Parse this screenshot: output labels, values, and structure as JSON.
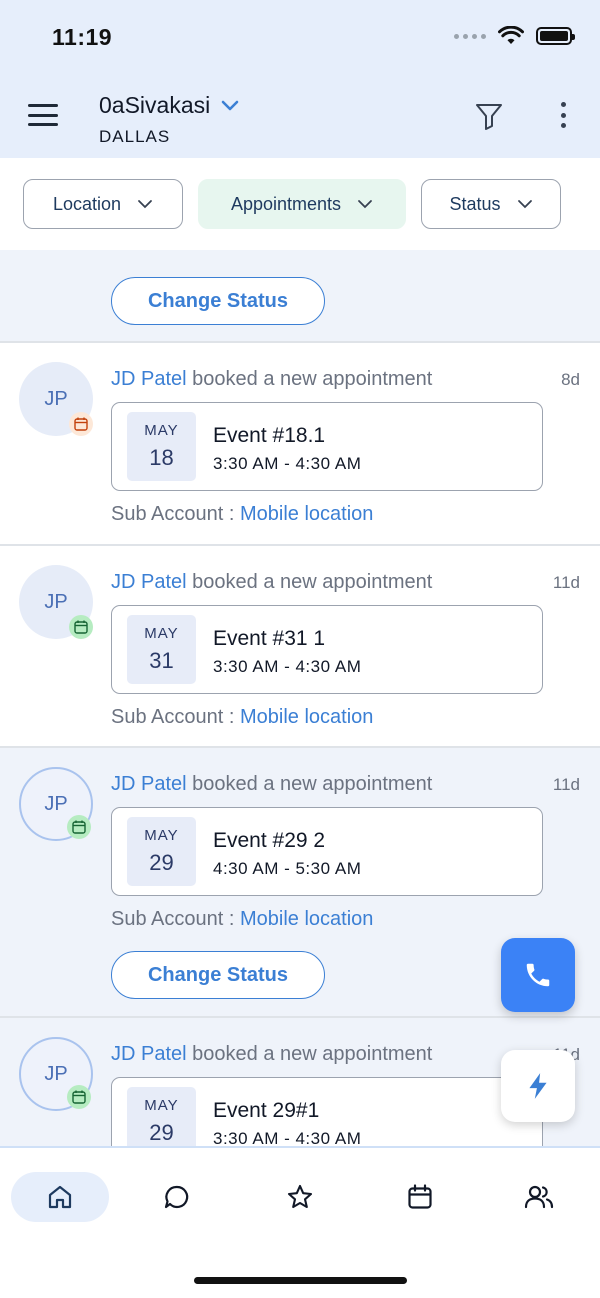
{
  "status_bar": {
    "time": "11:19"
  },
  "header": {
    "account_name": "0aSivakasi",
    "account_sub": "DALLAS"
  },
  "filters": [
    {
      "label": "Location",
      "active": false
    },
    {
      "label": "Appointments",
      "active": true
    },
    {
      "label": "Status",
      "active": false
    }
  ],
  "partial_top": {
    "change_status_label": "Change Status"
  },
  "feed": [
    {
      "initials": "JP",
      "person": "JD Patel",
      "action": "booked a new appointment",
      "ago": "8d",
      "month": "MAY",
      "day": "18",
      "event_title": "Event #18.1",
      "event_time": "3:30 AM - 4:30 AM",
      "sub_account_label": "Sub Account :",
      "sub_account_value": "Mobile location",
      "badge_color": "#fde8d8"
    },
    {
      "initials": "JP",
      "person": "JD Patel",
      "action": "booked a new appointment",
      "ago": "11d",
      "month": "MAY",
      "day": "31",
      "event_title": "Event #31 1",
      "event_time": "3:30 AM - 4:30 AM",
      "sub_account_label": "Sub Account :",
      "sub_account_value": "Mobile location",
      "badge_color": "#b6ecc1"
    },
    {
      "initials": "JP",
      "person": "JD Patel",
      "action": "booked a new appointment",
      "ago": "11d",
      "month": "MAY",
      "day": "29",
      "event_title": "Event #29 2",
      "event_time": "4:30 AM - 5:30 AM",
      "sub_account_label": "Sub Account :",
      "sub_account_value": "Mobile location",
      "change_status_label": "Change Status",
      "badge_color": "#b6ecc1"
    },
    {
      "initials": "JP",
      "person": "JD Patel",
      "action": "booked a new appointment",
      "ago": "11d",
      "month": "MAY",
      "day": "29",
      "event_title": "Event 29#1",
      "event_time": "3:30 AM - 4:30 AM",
      "badge_color": "#b6ecc1"
    }
  ],
  "colors": {
    "accent": "#3b7fd4",
    "fab": "#3b82f6",
    "header_bg": "#e6eefb",
    "chip_active": "#e7f6ef"
  },
  "bottom_nav": [
    {
      "icon": "home-icon",
      "active": true
    },
    {
      "icon": "chat-icon",
      "active": false
    },
    {
      "icon": "star-icon",
      "active": false
    },
    {
      "icon": "calendar-icon",
      "active": false
    },
    {
      "icon": "contacts-icon",
      "active": false
    }
  ]
}
